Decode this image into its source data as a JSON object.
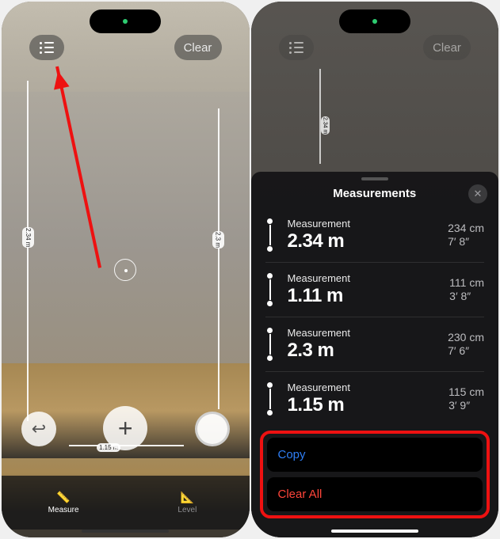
{
  "left": {
    "clear": "Clear",
    "labels": {
      "v1": "2.34 m",
      "v2": "2.3 m",
      "h1": "1.15 m"
    },
    "tabs": {
      "measure": "Measure",
      "level": "Level"
    }
  },
  "right": {
    "clear": "Clear",
    "labels": {
      "v1": "2.34 m"
    },
    "sheet": {
      "title": "Measurements",
      "items": [
        {
          "label": "Measurement",
          "value": "2.34 m",
          "alt1": "234 cm",
          "alt2": "7′ 8″"
        },
        {
          "label": "Measurement",
          "value": "1.11 m",
          "alt1": "111 cm",
          "alt2": "3′ 8″"
        },
        {
          "label": "Measurement",
          "value": "2.3 m",
          "alt1": "230 cm",
          "alt2": "7′ 6″"
        },
        {
          "label": "Measurement",
          "value": "1.15 m",
          "alt1": "115 cm",
          "alt2": "3′ 9″"
        }
      ],
      "copy": "Copy",
      "clear_all": "Clear All"
    }
  }
}
